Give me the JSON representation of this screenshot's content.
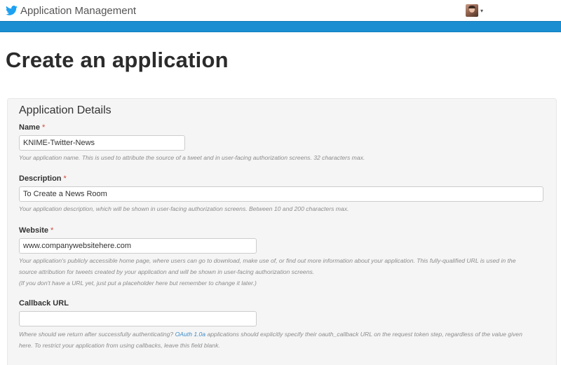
{
  "header": {
    "title": "Application Management",
    "brand_color": "#1da1f2",
    "band_color": "#1a8ed1",
    "user_avatar_icon": "user-avatar",
    "user_menu_caret": "▾"
  },
  "page": {
    "title": "Create an application"
  },
  "form": {
    "heading": "Application Details",
    "required_mark": "*",
    "name": {
      "label": "Name",
      "value": "KNIME-Twitter-News",
      "help": "Your application name. This is used to attribute the source of a tweet and in user-facing authorization screens. 32 characters max."
    },
    "description": {
      "label": "Description",
      "value": "To Create a News Room",
      "help": "Your application description, which will be shown in user-facing authorization screens. Between 10 and 200 characters max."
    },
    "website": {
      "label": "Website",
      "value": "www.companywebsitehere.com",
      "help_line1": "Your application's publicly accessible home page, where users can go to download, make use of, or find out more information about your application. This fully-qualified URL is used in the",
      "help_line2": "source attribution for tweets created by your application and will be shown in user-facing authorization screens.",
      "help_line3": "(If you don't have a URL yet, just put a placeholder here but remember to change it later.)"
    },
    "callback": {
      "label": "Callback URL",
      "value": "",
      "help_pre": "Where should we return after successfully authenticating?",
      "help_link": "OAuth 1.0a",
      "help_post": "applications should explicitly specify their oauth_callback URL on the request token step, regardless of the value given",
      "help_line2": "here. To restrict your application from using callbacks, leave this field blank."
    }
  }
}
